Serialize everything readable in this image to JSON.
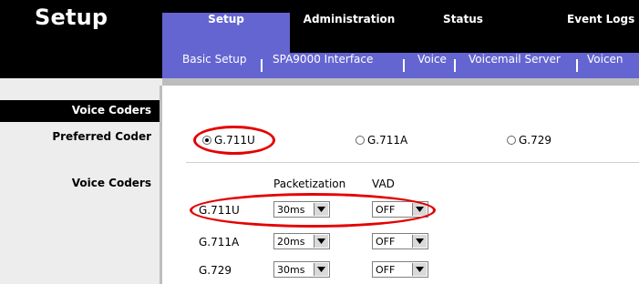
{
  "brand": "Setup",
  "tabs": [
    {
      "label": "Setup",
      "active": true
    },
    {
      "label": "Administration",
      "active": false
    },
    {
      "label": "Status",
      "active": false
    },
    {
      "label": "Event Logs",
      "active": false
    }
  ],
  "subnav": [
    "Basic Setup",
    "SPA9000 Interface",
    "Voice",
    "Voicemail Server",
    "Voicen"
  ],
  "sidebar": {
    "section_title": "Voice Coders",
    "preferred_coder_label": "Preferred Coder",
    "voice_coders_label": "Voice Coders"
  },
  "preferred_coder": {
    "options": [
      "G.711U",
      "G.711A",
      "G.729"
    ],
    "selected": "G.711U"
  },
  "coders_table": {
    "headers": {
      "packetization": "Packetization",
      "vad": "VAD"
    },
    "rows": [
      {
        "codec": "G.711U",
        "packetization": "30ms",
        "vad": "OFF"
      },
      {
        "codec": "G.711A",
        "packetization": "20ms",
        "vad": "OFF"
      },
      {
        "codec": "G.729",
        "packetization": "30ms",
        "vad": "OFF"
      }
    ]
  },
  "colors": {
    "tab_active": "#6565d2",
    "highlight": "#e50000",
    "header": "#000000"
  }
}
